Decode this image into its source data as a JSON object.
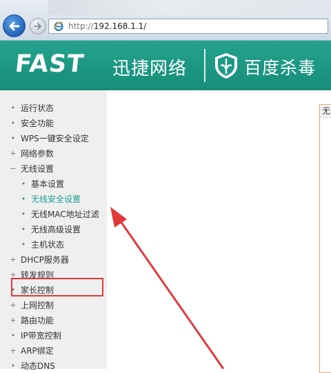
{
  "browser": {
    "url_protocol": "http://",
    "url_host": "192.168.1.1/",
    "icons": {
      "back": "back-arrow-icon",
      "forward": "forward-arrow-icon",
      "page": "ie-page-icon"
    }
  },
  "banner": {
    "brand": "FAST",
    "brand_cn": "迅捷网络",
    "antivirus": "百度杀毒",
    "colors": {
      "background": "#1b9a84",
      "text": "#ffffff"
    }
  },
  "sidebar": {
    "items": [
      {
        "label": "运行状态",
        "marker": "•"
      },
      {
        "label": "安全功能",
        "marker": "•"
      },
      {
        "label": "WPS一键安全设定",
        "marker": "•"
      },
      {
        "label": "网络参数",
        "marker": "+"
      },
      {
        "label": "无线设置",
        "marker": "−"
      },
      {
        "label": "基本设置",
        "marker": "•"
      },
      {
        "label": "无线安全设置",
        "marker": "•"
      },
      {
        "label": "无线MAC地址过滤",
        "marker": "•"
      },
      {
        "label": "无线高级设置",
        "marker": "•"
      },
      {
        "label": "主机状态",
        "marker": "•"
      },
      {
        "label": "DHCP服务器",
        "marker": "+"
      },
      {
        "label": "转发规则",
        "marker": "+"
      },
      {
        "label": "家长控制",
        "marker": "•"
      },
      {
        "label": "上网控制",
        "marker": "+"
      },
      {
        "label": "路由功能",
        "marker": "+"
      },
      {
        "label": "IP带宽控制",
        "marker": "•"
      },
      {
        "label": "ARP绑定",
        "marker": "+"
      },
      {
        "label": "动态DNS",
        "marker": "•"
      }
    ],
    "active_color": "#1aa08c"
  },
  "main": {
    "panel_title": "无"
  },
  "annotation": {
    "color": "#e0393b"
  }
}
